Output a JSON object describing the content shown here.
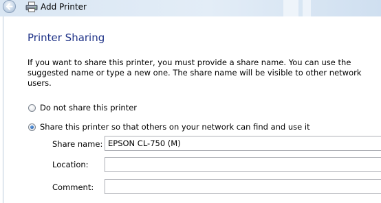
{
  "window": {
    "title": "Add Printer"
  },
  "page": {
    "heading": "Printer Sharing",
    "description": "If you want to share this printer, you must provide a share name. You can use the suggested name or type a new one. The share name will be visible to other network users."
  },
  "sharing_options": {
    "do_not_share": {
      "label": "Do not share this printer",
      "selected": false
    },
    "share": {
      "label": "Share this printer so that others on your network can find and use it",
      "selected": true
    }
  },
  "fields": {
    "share_name": {
      "label": "Share name:",
      "value": "EPSON CL-750 (M)"
    },
    "location": {
      "label": "Location:",
      "value": ""
    },
    "comment": {
      "label": "Comment:",
      "value": ""
    }
  },
  "colors": {
    "heading": "#1e3287",
    "titlebar": "#d9e6f3"
  },
  "icons": {
    "back": "back-arrow-icon",
    "printer": "printer-icon"
  }
}
